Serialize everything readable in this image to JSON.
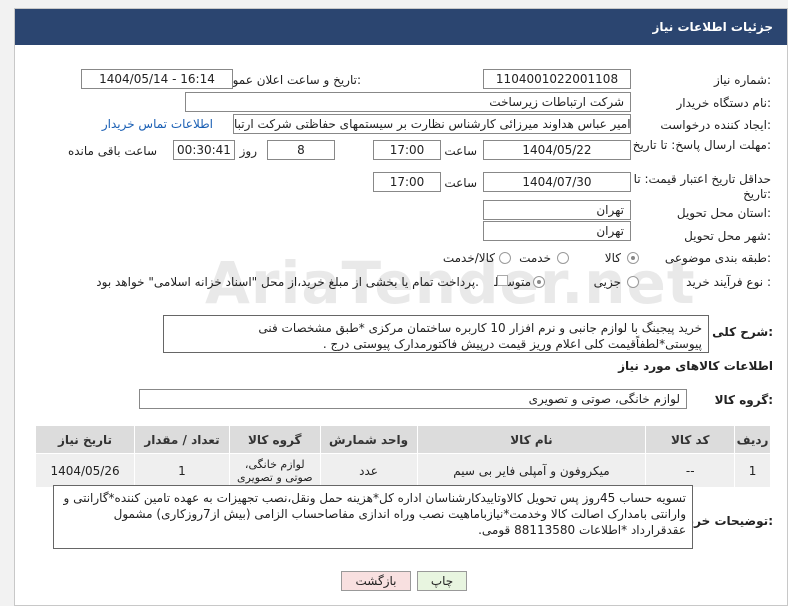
{
  "header": {
    "title": "جزئیات اطلاعات نیاز"
  },
  "form": {
    "need_number_label": "شماره نیاز:",
    "need_number": "1104001022001108",
    "announce_label": "تاریخ و ساعت اعلان عمومی:",
    "announce_value": "1404/05/14 - 16:14",
    "buyer_org_label": "نام دستگاه خریدار:",
    "buyer_org": "شرکت ارتباطات زیرساخت",
    "creator_label": "ایجاد کننده درخواست:",
    "creator": "امیر عباس هداوند میرزائی کارشناس نظارت بر سیستمهای حفاظتی شرکت ارتبا",
    "contact_link": "اطلاعات تماس خریدار",
    "reply_deadline_label": "مهلت ارسال پاسخ: تا تاریخ:",
    "reply_date": "1404/05/22",
    "time_label": "ساعت",
    "reply_time": "17:00",
    "days_value": "8",
    "days_label": "روز و",
    "remaining_time": "00:30:41",
    "remaining_label": "ساعت باقی مانده",
    "price_validity_label": "حداقل تاریخ اعتبار قیمت: تا تاریخ:",
    "price_date": "1404/07/30",
    "price_time": "17:00",
    "province_label": "استان محل تحویل:",
    "province": "تهران",
    "city_label": "شهر محل تحویل:",
    "city": "تهران",
    "category_label": "طبقه بندی موضوعی:",
    "category_options": [
      "کالا",
      "خدمت",
      "کالا/خدمت"
    ],
    "process_label": "نوع فرآیند خرید :",
    "process_options": [
      "جزیی",
      "متوسط"
    ],
    "payment_note": "پرداخت تمام یا بخشی از مبلغ خرید،از محل \"اسناد خزانه اسلامی\" خواهد بود."
  },
  "description": {
    "label": "شرح کلی نیاز:",
    "text": "خرید پیجینگ با لوازم جانبی و نرم افزار 10 کاربره ساختمان مرکزی *طبق مشخصات فنی پیوستی*لطفاًقیمت کلی اعلام وریز قیمت درپیش فاکتورمدارک پیوستی درج ."
  },
  "goods_info": {
    "title": "اطلاعات کالاهای مورد نیاز",
    "group_label": "گروه کالا:",
    "group_value": "لوازم خانگی، صوتی و تصویری"
  },
  "table": {
    "headers": [
      "ردیف",
      "کد کالا",
      "نام کالا",
      "واحد شمارش",
      "گروه کالا",
      "تعداد / مقدار",
      "تاریخ نیاز"
    ],
    "rows": [
      [
        "1",
        "--",
        "میکروفون و آمپلی فایر بی سیم",
        "عدد",
        "لوازم خانگی، صوتی و تصویری",
        "1",
        "1404/05/26"
      ]
    ]
  },
  "buyer_notes": {
    "label": "توضیحات خریدار:",
    "text": "تسویه حساب 45روز پس تحویل کالاوتاییدکارشناسان  اداره کل*هزینه حمل ونقل،نصب تجهیزات به عهده تامین کننده*گارانتی و وارانتی بامدارک اصالت کالا وخدمت*نیازباماهیت نصب وراه اندازی مفاصاحساب الزامی (بیش از7روزکاری) مشمول عقدقرارداد *اطلاعات 88113580 قومی."
  },
  "buttons": {
    "print": "چاپ",
    "back": "بازگشت"
  },
  "colors": {
    "header_bg": "#2b4570",
    "print_bg": "#e8f5e0",
    "back_bg": "#f8e0e0"
  }
}
